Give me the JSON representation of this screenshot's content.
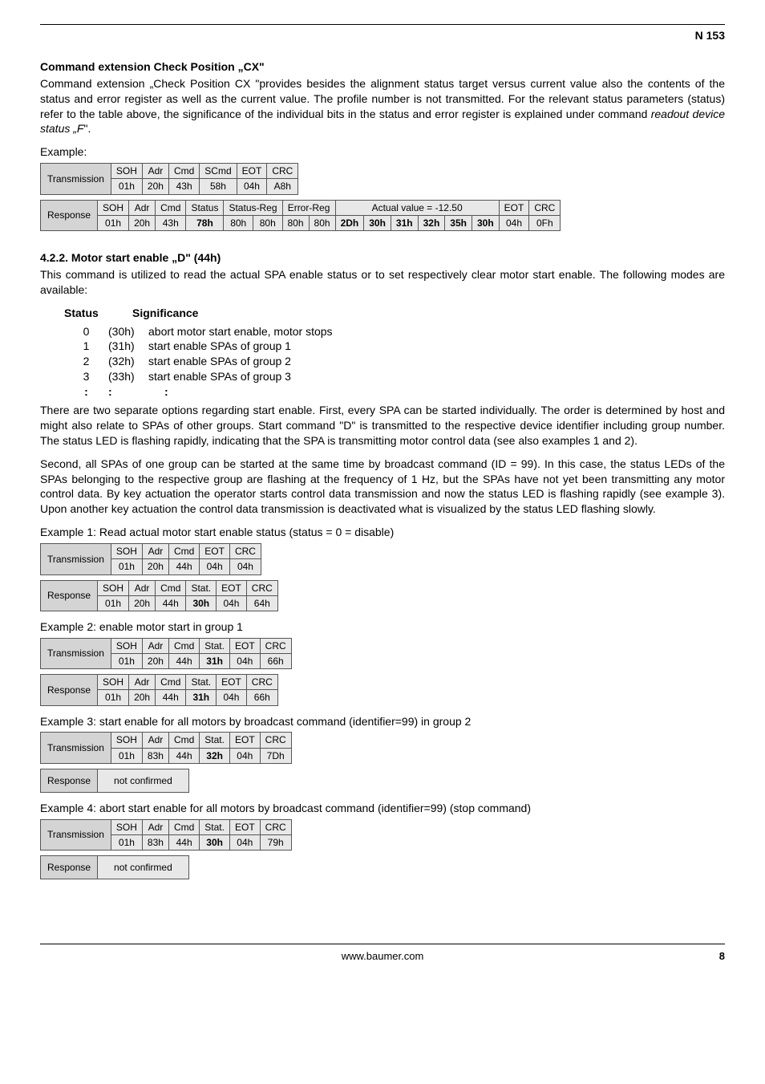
{
  "header": {
    "doc_id": "N 153"
  },
  "section_cx": {
    "title": "Command extension Check Position „CX\"",
    "para": "Command extension „Check Position CX \"provides besides the alignment status target versus current value also the contents of the status and error register as well as the current value. The profile number is not transmitted. For the relevant status parameters (status) refer to the table above, the significance of the individual bits in the status and error register is explained under command ",
    "para_italic": "readout device status „F",
    "para_end": "\".",
    "example_label": "Example:",
    "tx": {
      "label": "Transmission",
      "h": [
        "SOH",
        "Adr",
        "Cmd",
        "SCmd",
        "EOT",
        "CRC"
      ],
      "v": [
        "01h",
        "20h",
        "43h",
        "58h",
        "04h",
        "A8h"
      ]
    },
    "rx": {
      "label": "Response",
      "h": [
        "SOH",
        "Adr",
        "Cmd",
        "Status",
        "Status-Reg",
        "Error-Reg",
        "Actual value = -12.50",
        "EOT",
        "CRC"
      ],
      "v": [
        "01h",
        "20h",
        "43h",
        "78h",
        "80h",
        "80h",
        "80h",
        "80h",
        "2Dh",
        "30h",
        "31h",
        "32h",
        "35h",
        "30h",
        "04h",
        "0Fh"
      ],
      "spans": [
        1,
        1,
        1,
        1,
        2,
        2,
        6,
        1,
        1
      ]
    }
  },
  "section_d": {
    "title": "4.2.2. Motor start enable „D\" (44h)",
    "intro": "This command is utilized to read the actual SPA enable status or to set respectively clear motor start enable. The following modes are available:",
    "status_head": {
      "c1": "Status",
      "c2": "Significance"
    },
    "status_rows": [
      {
        "n": "0",
        "hex": "(30h)",
        "txt": "abort motor start enable, motor stops"
      },
      {
        "n": "1",
        "hex": "(31h)",
        "txt": "start enable SPAs of group 1"
      },
      {
        "n": "2",
        "hex": "(32h)",
        "txt": "start enable SPAs of group 2"
      },
      {
        "n": "3",
        "hex": "(33h)",
        "txt": "start enable SPAs of group 3"
      },
      {
        "n": ":",
        "hex": ":",
        "txt": ":"
      }
    ],
    "para1": "There are two separate options regarding start enable. First, every SPA can be started individually. The order is determined by host and might also relate to SPAs of other groups. Start command \"D\" is transmitted to the respective device identifier including group number. The status LED is flashing rapidly, indicating that the SPA is transmitting motor control data (see also examples 1 and 2).",
    "para2": "Second, all SPAs of one group can be started at the same time by broadcast command (ID = 99). In this case, the status LEDs of the SPAs belonging to the respective group are flashing at the frequency of 1 Hz, but the SPAs have not yet been transmitting any motor control data. By key actuation the operator starts control data transmission and now the status LED is flashing rapidly (see example 3). Upon another key actuation the control data transmission is deactivated what is visualized by the status LED flashing slowly.",
    "ex1": {
      "label": "Example 1: Read actual motor start enable status  (status = 0 = disable)",
      "tx": {
        "label": "Transmission",
        "h": [
          "SOH",
          "Adr",
          "Cmd",
          "EOT",
          "CRC"
        ],
        "v": [
          "01h",
          "20h",
          "44h",
          "04h",
          "04h"
        ]
      },
      "rx": {
        "label": "Response",
        "h": [
          "SOH",
          "Adr",
          "Cmd",
          "Stat.",
          "EOT",
          "CRC"
        ],
        "v": [
          "01h",
          "20h",
          "44h",
          "30h",
          "04h",
          "64h"
        ],
        "bold": 3
      }
    },
    "ex2": {
      "label": "Example 2: enable motor start in group 1",
      "tx": {
        "label": "Transmission",
        "h": [
          "SOH",
          "Adr",
          "Cmd",
          "Stat.",
          "EOT",
          "CRC"
        ],
        "v": [
          "01h",
          "20h",
          "44h",
          "31h",
          "04h",
          "66h"
        ],
        "bold": 3
      },
      "rx": {
        "label": "Response",
        "h": [
          "SOH",
          "Adr",
          "Cmd",
          "Stat.",
          "EOT",
          "CRC"
        ],
        "v": [
          "01h",
          "20h",
          "44h",
          "31h",
          "04h",
          "66h"
        ],
        "bold": 3
      }
    },
    "ex3": {
      "label": "Example 3: start enable for all motors by broadcast command (identifier=99) in group 2",
      "tx": {
        "label": "Transmission",
        "h": [
          "SOH",
          "Adr",
          "Cmd",
          "Stat.",
          "EOT",
          "CRC"
        ],
        "v": [
          "01h",
          "83h",
          "44h",
          "32h",
          "04h",
          "7Dh"
        ],
        "bold": 3
      },
      "rx": {
        "label": "Response",
        "txt": "not confirmed"
      }
    },
    "ex4": {
      "label": "Example 4: abort start enable for all motors by broadcast command (identifier=99) (stop command)",
      "tx": {
        "label": "Transmission",
        "h": [
          "SOH",
          "Adr",
          "Cmd",
          "Stat.",
          "EOT",
          "CRC"
        ],
        "v": [
          "01h",
          "83h",
          "44h",
          "30h",
          "04h",
          "79h"
        ],
        "bold": 3
      },
      "rx": {
        "label": "Response",
        "txt": "not confirmed"
      }
    }
  },
  "footer": {
    "url": "www.baumer.com",
    "page": "8"
  }
}
